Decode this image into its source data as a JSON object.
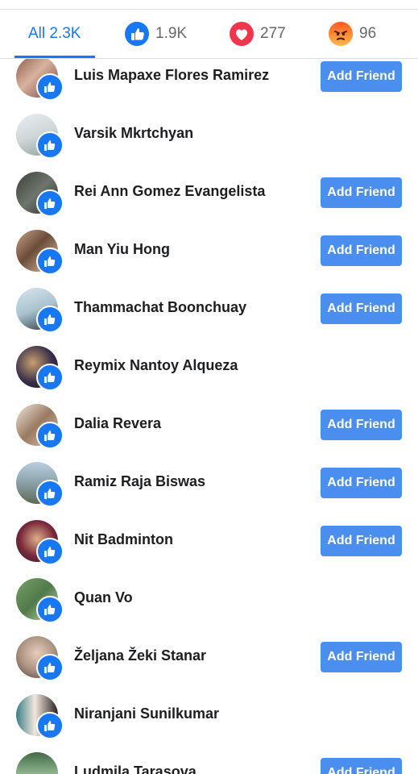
{
  "tabs": [
    {
      "label": "All 2.3K",
      "count": "",
      "icon": ""
    },
    {
      "label": "",
      "count": "1.9K",
      "icon": "like-icon"
    },
    {
      "label": "",
      "count": "277",
      "icon": "love-icon"
    },
    {
      "label": "",
      "count": "96",
      "icon": "angry-icon"
    }
  ],
  "add_friend_label": "Add Friend",
  "people": [
    {
      "name": "Luis Mapaxe Flores Ramirez",
      "add_friend": true
    },
    {
      "name": "Varsik Mkrtchyan",
      "add_friend": false
    },
    {
      "name": "Rei Ann Gomez Evangelista",
      "add_friend": true
    },
    {
      "name": "Man Yiu Hong",
      "add_friend": true
    },
    {
      "name": "Thammachat Boonchuay",
      "add_friend": true
    },
    {
      "name": "Reymix Nantoy Alqueza",
      "add_friend": false
    },
    {
      "name": "Dalia Revera",
      "add_friend": true
    },
    {
      "name": "Ramiz Raja Biswas",
      "add_friend": true
    },
    {
      "name": "Nit Badminton",
      "add_friend": true
    },
    {
      "name": "Quan Vo",
      "add_friend": false
    },
    {
      "name": "Željana Žeki Stanar",
      "add_friend": true
    },
    {
      "name": "Niranjani Sunilkumar",
      "add_friend": false
    },
    {
      "name": "Ludmila Tarasova",
      "add_friend": true
    }
  ],
  "colors": {
    "accent": "#1877f2",
    "button": "#4a8ff0",
    "love": "#f0354d",
    "angry": "#ff7a2f"
  }
}
